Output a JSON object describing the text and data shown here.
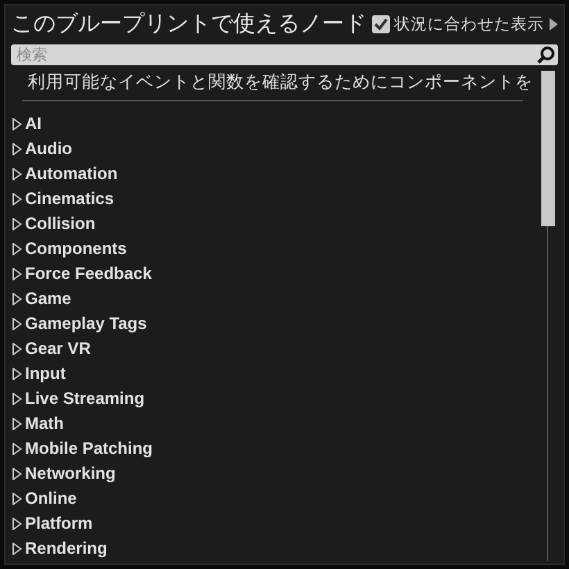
{
  "title": "このブループリントで使えるノード",
  "context_toggle": {
    "label": "状況に合わせた表示",
    "checked": true
  },
  "search": {
    "placeholder": "検索"
  },
  "notice": "利用可能なイベントと関数を確認するためにコンポーネントを",
  "categories": [
    {
      "label": "AI",
      "expanded": false
    },
    {
      "label": "Audio",
      "expanded": false
    },
    {
      "label": "Automation",
      "expanded": false
    },
    {
      "label": "Cinematics",
      "expanded": false
    },
    {
      "label": "Collision",
      "expanded": false
    },
    {
      "label": "Components",
      "expanded": false
    },
    {
      "label": "Force Feedback",
      "expanded": false
    },
    {
      "label": "Game",
      "expanded": false
    },
    {
      "label": "Gameplay Tags",
      "expanded": false
    },
    {
      "label": "Gear VR",
      "expanded": false
    },
    {
      "label": "Input",
      "expanded": false
    },
    {
      "label": "Live Streaming",
      "expanded": false
    },
    {
      "label": "Math",
      "expanded": false
    },
    {
      "label": "Mobile Patching",
      "expanded": false
    },
    {
      "label": "Networking",
      "expanded": false
    },
    {
      "label": "Online",
      "expanded": false
    },
    {
      "label": "Platform",
      "expanded": false
    },
    {
      "label": "Rendering",
      "expanded": false
    }
  ]
}
